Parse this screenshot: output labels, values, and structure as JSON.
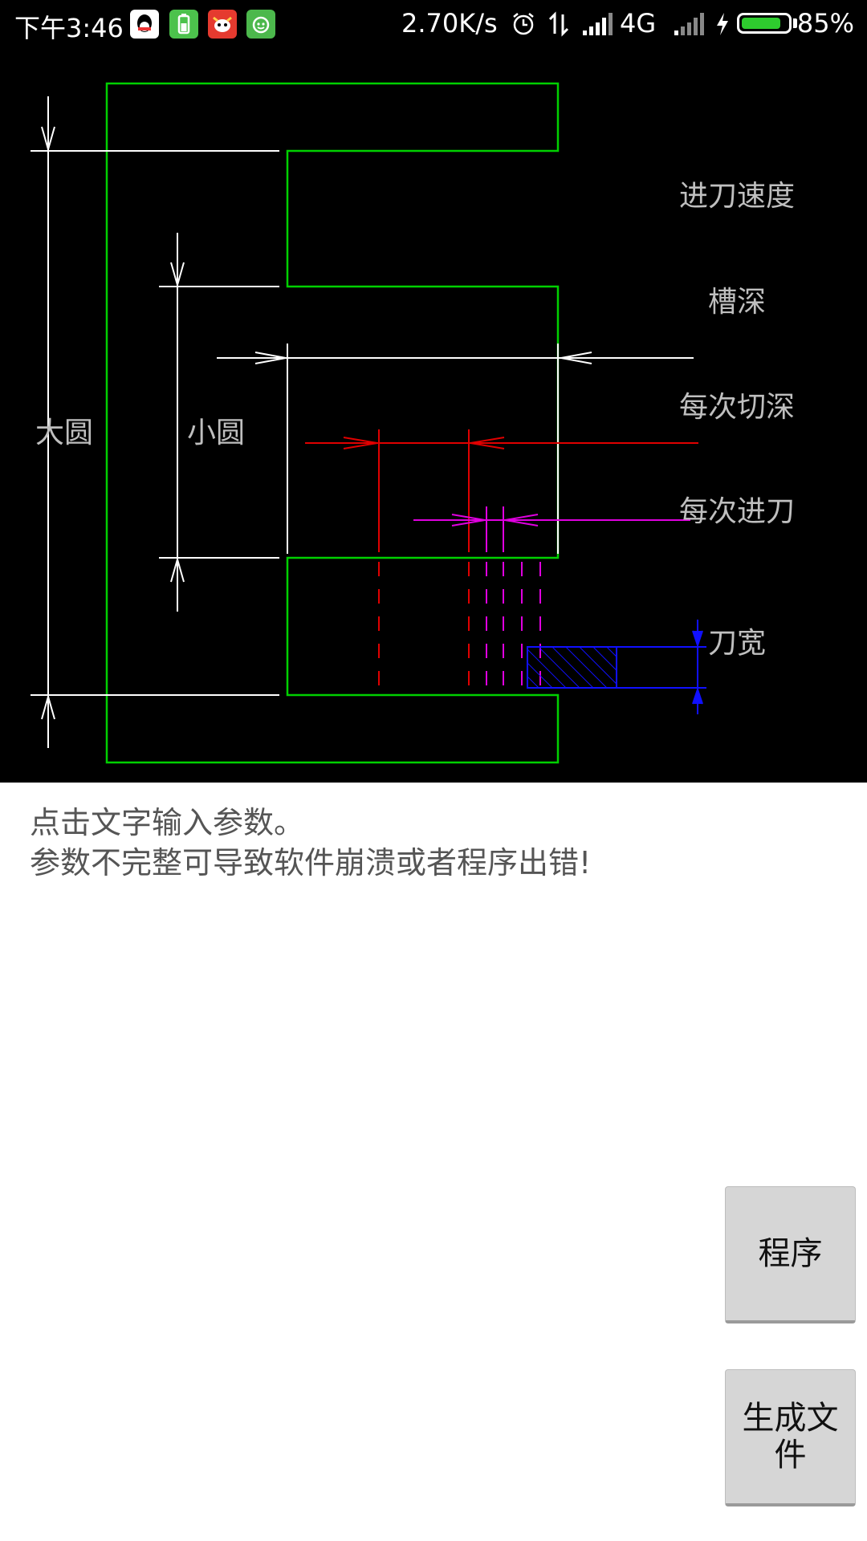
{
  "status_bar": {
    "time": "下午3:46",
    "speed": "2.70K/s",
    "network": "4G",
    "battery": "85%",
    "battery_level": 0.85,
    "icons": [
      "qq-icon",
      "battery-app-icon",
      "red-cow-icon",
      "green-face-icon",
      "alarm-icon",
      "data-transfer-icon",
      "signal-icon",
      "signal-weak-icon",
      "charging-icon"
    ]
  },
  "diagram": {
    "labels": {
      "feed_speed": "进刀速度",
      "groove_depth": "槽深",
      "cut_depth_each": "每次切深",
      "feed_each": "每次进刀",
      "large_circle": "大圆",
      "small_circle": "小圆",
      "tool_width": "刀宽"
    },
    "colors": {
      "outline": "#00d000",
      "dimension": "#ffffff",
      "red_dim": "#e00000",
      "magenta_dim": "#e000e0",
      "tool": "#0000ff"
    }
  },
  "instructions": {
    "line1": "点击文字输入参数。",
    "line2": "参数不完整可导致软件崩溃或者程序出错!"
  },
  "buttons": {
    "program": "程序",
    "generate_file": "生成文件"
  }
}
